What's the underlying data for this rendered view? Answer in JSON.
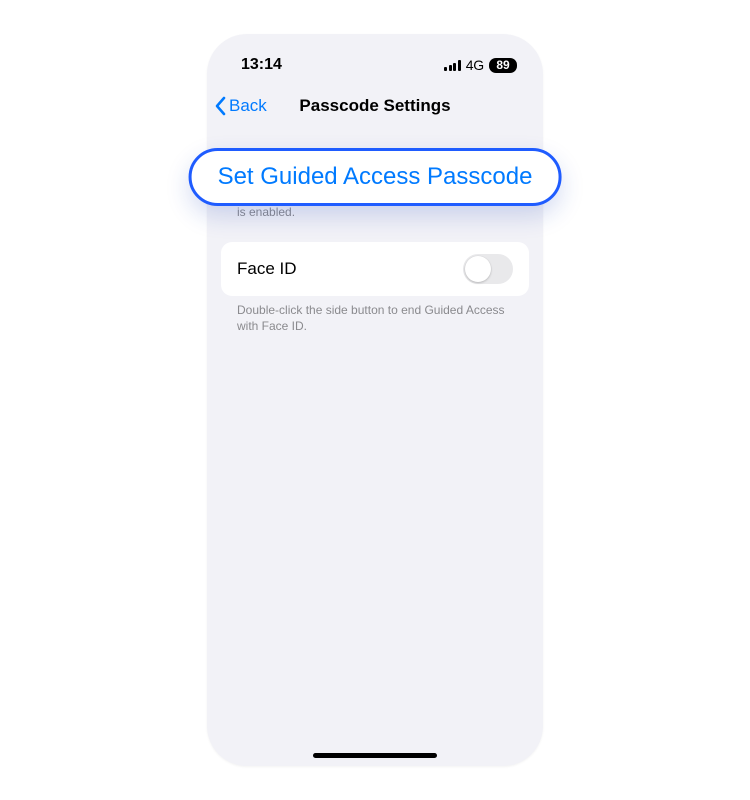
{
  "status": {
    "time": "13:14",
    "network": "4G",
    "battery": "89"
  },
  "nav": {
    "back_label": "Back",
    "title": "Passcode Settings"
  },
  "callout": {
    "label": "Set Guided Access Passcode"
  },
  "section1": {
    "footer_visible_fragment": "is enabled."
  },
  "section2": {
    "row_label": "Face ID",
    "toggle_on": false,
    "footer": "Double-click the side button to end Guided Access with Face ID."
  }
}
